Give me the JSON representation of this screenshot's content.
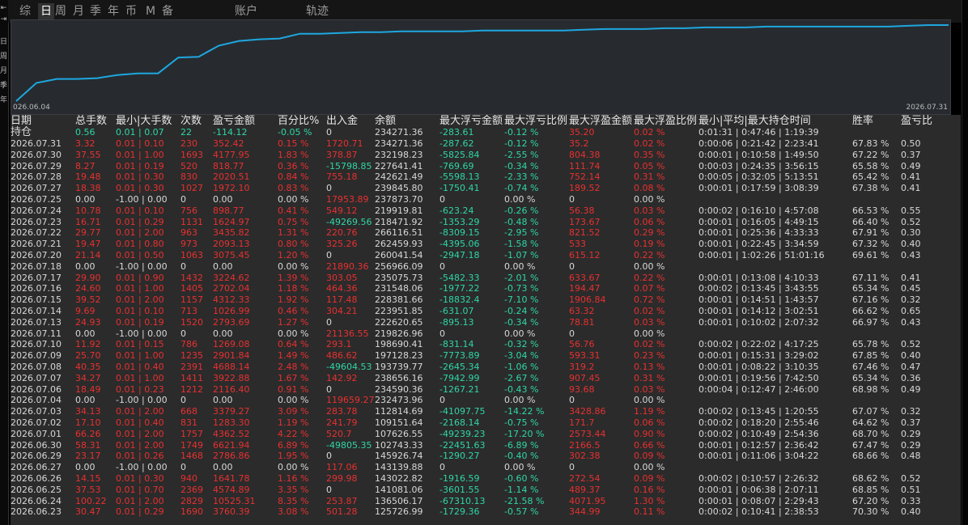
{
  "tabs": [
    "综",
    "日",
    "周",
    "月",
    "季",
    "年",
    "币",
    "M",
    "备",
    "账户",
    "轨迹"
  ],
  "active_tab": "日",
  "left_labels": [
    "⇤",
    "⇥",
    "日",
    "周",
    "月",
    "季",
    "年"
  ],
  "chart_data": {
    "type": "line",
    "x_start_label": "026.06.04",
    "x_end_label": "2026.07.31",
    "line_color": "#1ea7e0",
    "y": [
      2,
      25,
      30,
      30,
      31,
      35,
      37,
      37,
      57,
      58,
      72,
      78,
      80,
      81,
      87,
      87,
      88,
      89,
      89,
      90,
      90,
      90,
      90,
      91,
      91,
      91,
      91,
      91,
      92,
      93,
      93,
      93,
      94,
      94,
      95,
      95,
      95,
      96,
      96,
      96,
      96,
      96,
      96,
      96,
      97,
      98,
      98
    ]
  },
  "table": {
    "headers": [
      "日期",
      "总手数",
      "最小|大手数",
      "次数",
      "盈亏金额",
      "百分比%",
      "出入金",
      "余额",
      "最大浮亏金额",
      "最大浮亏比例",
      "最大浮盈金额",
      "最大浮盈比例",
      "最小|平均|最大持仓时间",
      "胜率",
      "盈亏比"
    ],
    "pos_row": [
      "持仓",
      "0.56",
      "0.01 | 0.07",
      "22",
      "-114.12",
      "-0.05 %",
      "0",
      "234271.36",
      "-283.61",
      "-0.12 %",
      "35.20",
      "0.02 %",
      "0:01:31 | 0:47:46 | 1:19:39",
      "",
      ""
    ],
    "rows": [
      [
        "2026.07.31",
        "3.32",
        "0.01 | 0.10",
        "230",
        "352.42",
        "0.15 %",
        "1720.71",
        "234271.36",
        "-287.62",
        "-0.12 %",
        "35.2",
        "0.02 %",
        "0:00:06 | 0:21:42 | 2:23:41",
        "67.83 %",
        "0.50"
      ],
      [
        "2026.07.30",
        "37.55",
        "0.01 | 1.00",
        "1693",
        "4177.95",
        "1.83 %",
        "378.87",
        "232198.23",
        "-5825.84",
        "-2.55 %",
        "804.38",
        "0.35 %",
        "0:00:01 | 0:10:58 | 1:49:50",
        "67.22 %",
        "0.37"
      ],
      [
        "2026.07.29",
        "8.27",
        "0.01 | 0.19",
        "520",
        "818.77",
        "0.36 %",
        "-15798.85",
        "227641.41",
        "-769.69",
        "-0.34 %",
        "111.74",
        "0.05 %",
        "0:00:03 | 0:24:35 | 3:56:15",
        "65.58 %",
        "0.49"
      ],
      [
        "2026.07.28",
        "19.48",
        "0.01 | 0.30",
        "830",
        "2020.51",
        "0.84 %",
        "755.18",
        "242621.49",
        "-5598.13",
        "-2.33 %",
        "752.14",
        "0.31 %",
        "0:00:05 | 0:32:05 | 5:13:51",
        "65.42 %",
        "0.41"
      ],
      [
        "2026.07.27",
        "18.38",
        "0.01 | 0.30",
        "1027",
        "1972.10",
        "0.83 %",
        "0",
        "239845.80",
        "-1750.41",
        "-0.74 %",
        "189.52",
        "0.08 %",
        "0:00:01 | 0:17:59 | 3:08:39",
        "67.38 %",
        "0.41"
      ],
      [
        "2026.07.25",
        "0.00",
        "-1.00 | 0.00",
        "0",
        "0.00",
        "0.00 %",
        "17953.89",
        "237873.70",
        "0",
        "0.00 %",
        "0",
        "0.00 %",
        "",
        "",
        ""
      ],
      [
        "2026.07.24",
        "10.78",
        "0.01 | 0.10",
        "756",
        "898.77",
        "0.41 %",
        "549.12",
        "219919.81",
        "-623.24",
        "-0.26 %",
        "56.38",
        "0.03 %",
        "0:00:02 | 0:16:10 | 4:57:08",
        "66.53 %",
        "0.55"
      ],
      [
        "2026.07.23",
        "16.71",
        "0.01 | 0.29",
        "1131",
        "1624.97",
        "0.75 %",
        "-49269.56",
        "218471.92",
        "-1353.29",
        "-0.48 %",
        "173.67",
        "0.06 %",
        "0:00:01 | 0:16:05 | 4:49:15",
        "66.40 %",
        "0.52"
      ],
      [
        "2026.07.22",
        "29.77",
        "0.01 | 2.00",
        "963",
        "3435.82",
        "1.31 %",
        "220.76",
        "266116.51",
        "-8309.15",
        "-2.95 %",
        "821.52",
        "0.29 %",
        "0:00:01 | 0:25:36 | 4:33:33",
        "67.91 %",
        "0.30"
      ],
      [
        "2026.07.21",
        "19.47",
        "0.01 | 0.80",
        "973",
        "2093.13",
        "0.80 %",
        "325.26",
        "262459.93",
        "-4395.06",
        "-1.58 %",
        "533",
        "0.19 %",
        "0:00:01 | 0:22:45 | 3:34:59",
        "67.32 %",
        "0.40"
      ],
      [
        "2026.07.20",
        "21.14",
        "0.01 | 0.50",
        "1063",
        "3075.45",
        "1.20 %",
        "0",
        "260041.54",
        "-2947.18",
        "-1.07 %",
        "615.12",
        "0.22 %",
        "0:00:01 | 1:02:26 | 51:01:16",
        "69.61 %",
        "0.43"
      ],
      [
        "2026.07.18",
        "0.00",
        "-1.00 | 0.00",
        "0",
        "0.00",
        "0.00 %",
        "21890.36",
        "256966.09",
        "0",
        "0.00 %",
        "0",
        "0.00 %",
        "",
        "",
        ""
      ],
      [
        "2026.07.17",
        "29.90",
        "0.01 | 0.90",
        "1432",
        "3224.62",
        "1.39 %",
        "303.05",
        "235075.73",
        "-5482.33",
        "-2.01 %",
        "633.67",
        "0.22 %",
        "0:00:01 | 0:13:08 | 4:10:33",
        "67.11 %",
        "0.41"
      ],
      [
        "2026.07.16",
        "24.60",
        "0.01 | 1.00",
        "1405",
        "2702.04",
        "1.18 %",
        "464.36",
        "231548.06",
        "-1977.22",
        "-0.73 %",
        "194.47",
        "0.07 %",
        "0:00:02 | 0:13:45 | 3:43:55",
        "65.34 %",
        "0.45"
      ],
      [
        "2026.07.15",
        "39.52",
        "0.01 | 2.00",
        "1157",
        "4312.33",
        "1.92 %",
        "117.48",
        "228381.66",
        "-18832.4",
        "-7.10 %",
        "1906.84",
        "0.72 %",
        "0:00:01 | 0:14:51 | 1:43:57",
        "67.16 %",
        "0.32"
      ],
      [
        "2026.07.14",
        "9.69",
        "0.01 | 0.10",
        "713",
        "1026.99",
        "0.46 %",
        "304.21",
        "223951.85",
        "-631.07",
        "-0.24 %",
        "63.32",
        "0.02 %",
        "0:00:01 | 0:14:12 | 3:02:51",
        "66.62 %",
        "0.65"
      ],
      [
        "2026.07.13",
        "24.93",
        "0.01 | 0.19",
        "1520",
        "2793.69",
        "1.27 %",
        "0",
        "222620.65",
        "-895.13",
        "-0.34 %",
        "78.81",
        "0.03 %",
        "0:00:01 | 0:10:02 | 2:07:32",
        "66.97 %",
        "0.43"
      ],
      [
        "2026.07.11",
        "0.00",
        "-1.00 | 0.00",
        "0",
        "0.00",
        "0.00 %",
        "21136.55",
        "219826.96",
        "0",
        "0.00 %",
        "0",
        "0.00 %",
        "",
        "",
        ""
      ],
      [
        "2026.07.10",
        "11.92",
        "0.01 | 0.15",
        "786",
        "1269.08",
        "0.64 %",
        "293.1",
        "198690.41",
        "-831.14",
        "-0.32 %",
        "56.76",
        "0.02 %",
        "0:00:02 | 0:22:02 | 4:17:25",
        "65.78 %",
        "0.52"
      ],
      [
        "2026.07.09",
        "25.70",
        "0.01 | 1.00",
        "1235",
        "2901.84",
        "1.49 %",
        "486.62",
        "197128.23",
        "-7773.89",
        "-3.04 %",
        "593.31",
        "0.23 %",
        "0:00:01 | 0:15:31 | 3:29:02",
        "67.85 %",
        "0.40"
      ],
      [
        "2026.07.08",
        "40.35",
        "0.01 | 0.40",
        "2391",
        "4688.14",
        "2.48 %",
        "-49604.53",
        "193739.77",
        "-2645.34",
        "-1.06 %",
        "319.2",
        "0.13 %",
        "0:00:01 | 0:08:22 | 3:10:35",
        "67.46 %",
        "0.47"
      ],
      [
        "2026.07.07",
        "34.27",
        "0.01 | 1.00",
        "1411",
        "3922.88",
        "1.67 %",
        "142.92",
        "238656.16",
        "-7942.99",
        "-2.67 %",
        "907.45",
        "0.31 %",
        "0:00:01 | 0:19:56 | 7:42:50",
        "65.34 %",
        "0.36"
      ],
      [
        "2026.07.06",
        "18.49",
        "0.01 | 0.23",
        "1212",
        "2116.40",
        "0.91 %",
        "0",
        "234590.36",
        "-1267.21",
        "-0.43 %",
        "93.68",
        "0.03 %",
        "0:00:04 | 0:12:47 | 2:46:00",
        "68.98 %",
        "0.49"
      ],
      [
        "2026.07.04",
        "0.00",
        "-1.00 | 0.00",
        "0",
        "0.00",
        "0.00 %",
        "119659.27",
        "232473.96",
        "0",
        "0.00 %",
        "0",
        "0.00 %",
        "",
        "",
        ""
      ],
      [
        "2026.07.03",
        "34.13",
        "0.01 | 2.00",
        "668",
        "3379.27",
        "3.09 %",
        "283.78",
        "112814.69",
        "-41097.75",
        "-14.22 %",
        "3428.86",
        "1.19 %",
        "0:00:02 | 0:13:45 | 1:20:55",
        "67.07 %",
        "0.32"
      ],
      [
        "2026.07.02",
        "17.10",
        "0.01 | 0.40",
        "831",
        "1283.30",
        "1.19 %",
        "241.79",
        "109151.64",
        "-2168.14",
        "-0.75 %",
        "171.7",
        "0.06 %",
        "0:00:02 | 0:18:20 | 2:55:46",
        "64.62 %",
        "0.37"
      ],
      [
        "2026.07.01",
        "66.26",
        "0.01 | 2.00",
        "1757",
        "4362.52",
        "4.22 %",
        "520.7",
        "107626.55",
        "-49239.23",
        "-17.20 %",
        "2573.44",
        "0.90 %",
        "0:00:02 | 0:10:49 | 2:54:36",
        "68.70 %",
        "0.29"
      ],
      [
        "2026.06.30",
        "58.31",
        "0.01 | 2.00",
        "1749",
        "6621.94",
        "6.89 %",
        "-49805.35",
        "102743.33",
        "-22451.63",
        "-6.89 %",
        "2166.5",
        "0.66 %",
        "0:00:01 | 0:12:57 | 2:36:42",
        "67.47 %",
        "0.29"
      ],
      [
        "2026.06.29",
        "23.17",
        "0.01 | 0.26",
        "1468",
        "2786.86",
        "1.95 %",
        "0",
        "145926.74",
        "-1290.27",
        "-0.40 %",
        "302.38",
        "0.09 %",
        "0:00:01 | 0:11:06 | 3:04:22",
        "68.66 %",
        "0.48"
      ],
      [
        "2026.06.27",
        "0.00",
        "-1.00 | 0.00",
        "0",
        "0.00",
        "0.00 %",
        "117.06",
        "143139.88",
        "0",
        "0.00 %",
        "0",
        "0.00 %",
        "",
        "",
        ""
      ],
      [
        "2026.06.26",
        "14.15",
        "0.01 | 0.30",
        "940",
        "1641.78",
        "1.16 %",
        "299.98",
        "143022.82",
        "-1916.59",
        "-0.60 %",
        "272.54",
        "0.09 %",
        "0:00:02 | 0:10:57 | 2:26:32",
        "68.62 %",
        "0.52"
      ],
      [
        "2026.06.25",
        "37.53",
        "0.01 | 0.70",
        "2369",
        "4574.89",
        "3.35 %",
        "0",
        "141081.06",
        "-3601.55",
        "-1.14 %",
        "489.37",
        "0.16 %",
        "0:00:01 | 0:06:38 | 2:07:11",
        "68.85 %",
        "0.51"
      ],
      [
        "2026.06.24",
        "100.22",
        "0.01 | 2.00",
        "2829",
        "10525.31",
        "8.35 %",
        "253.87",
        "136506.17",
        "-67310.13",
        "-21.58 %",
        "4071.95",
        "1.30 %",
        "0:00:01 | 0:08:07 | 2:29:43",
        "67.20 %",
        "0.33"
      ],
      [
        "2026.06.23",
        "30.47",
        "0.01 | 0.29",
        "1690",
        "3760.39",
        "3.08 %",
        "501.28",
        "125726.99",
        "-1729.36",
        "-0.57 %",
        "344.99",
        "0.11 %",
        "0:00:02 | 0:10:41 | 2:38:53",
        "70.30 %",
        "0.40"
      ]
    ]
  }
}
